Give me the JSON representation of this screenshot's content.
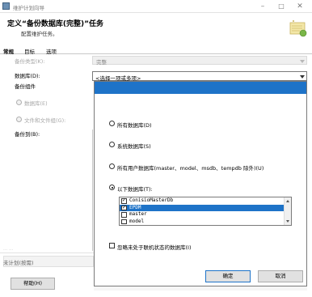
{
  "window": {
    "title": "维护计划向导",
    "min_glyph": "–",
    "max_glyph": "□",
    "close_glyph": "✕"
  },
  "header": {
    "title": "定义“备份数据库(完整)”任务",
    "subtitle": "配置维护任务。"
  },
  "tabs": [
    "常规",
    "目标",
    "选项"
  ],
  "form": {
    "backup_type_label": "备份类型(K):",
    "backup_type_value": "完整",
    "database_label": "数据库(D):",
    "database_value": "<选择一项或多项>",
    "backup_component_label": "备份组件",
    "database_radio_label": "数据库(E)",
    "file_radio_label": "文件和文件组(G):",
    "backup_to_label": "备份到(B):"
  },
  "dropdown": {
    "options": [
      {
        "label": "所有数据库(D)",
        "checked": false
      },
      {
        "label": "系统数据库(S)",
        "checked": false
      },
      {
        "label": "所有用户数据库(master、model、msdb、tempdb 除外)(U)",
        "checked": false
      },
      {
        "label": "以下数据库(T):",
        "checked": true
      }
    ],
    "databases": [
      {
        "name": "ConisioMasterDb",
        "checked": true,
        "selected": false
      },
      {
        "name": "EPDM",
        "checked": true,
        "selected": true
      },
      {
        "name": "master",
        "checked": false,
        "selected": false
      },
      {
        "name": "model",
        "checked": false,
        "selected": false
      }
    ],
    "ignore_offline_label": "忽略未处于联机状态的数据库(I)",
    "ok_label": "确定",
    "cancel_label": "取消"
  },
  "footer": {
    "faded_label": "···  ···",
    "schedule_text": "未计划(按需)",
    "help_label": "帮助(H)"
  },
  "colors": {
    "selection_blue": "#1e73c8"
  }
}
